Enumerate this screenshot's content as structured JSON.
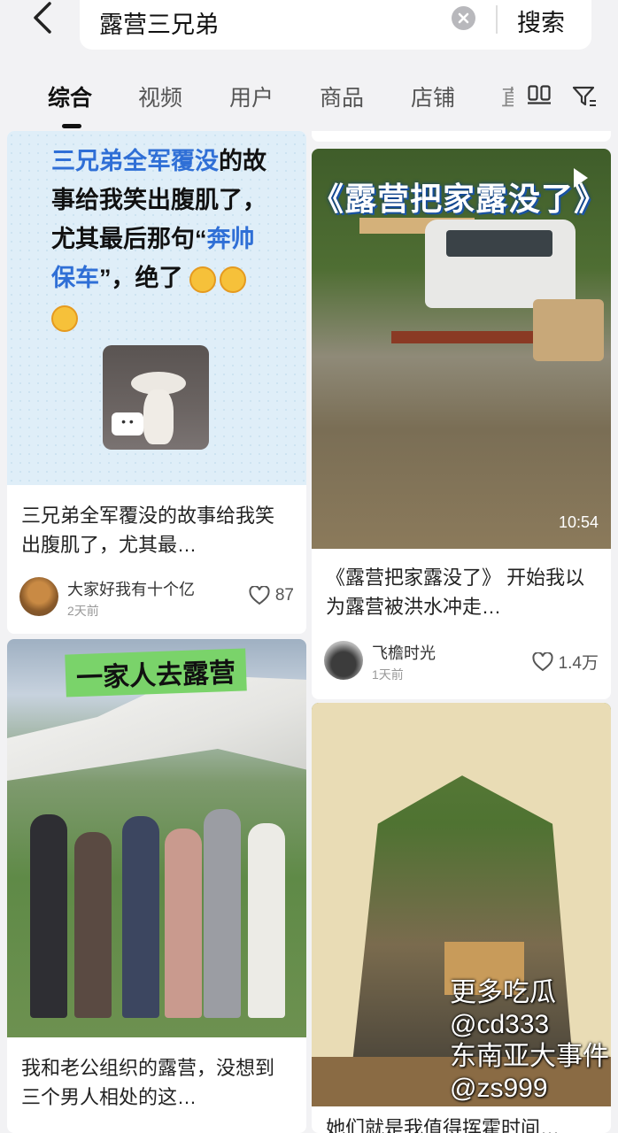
{
  "search": {
    "query": "露营三兄弟",
    "submit_label": "搜索"
  },
  "tabs": [
    "综合",
    "视频",
    "用户",
    "商品",
    "店铺"
  ],
  "cards": [
    {
      "title": "三兄弟全军覆没的故事给我笑出腹肌了，尤其最…",
      "meme_lines": [
        "三兄弟全军覆没",
        "的故事给我笑出腹肌了，尤其最后那句",
        "“",
        "奔帅保车",
        "”，绝了"
      ],
      "author": "大家好我有十个亿",
      "ago": "2天前",
      "likes": "87"
    },
    {
      "image_title": "《露营把家露没了》",
      "duration": "10:54",
      "title": "《露营把家露没了》 开始我以为露营被洪水冲走…",
      "author": "飞檐时光",
      "ago": "1天前",
      "likes": "1.4万"
    },
    {
      "image_title": "一家人去露营",
      "title": "我和老公组织的露营，没想到三个男人相处的这…"
    },
    {
      "title": "她们就是我值得挥霍时间…"
    }
  ],
  "watermark": [
    "更多吃瓜",
    "@cd333",
    "东南亚大事件",
    "@zs999"
  ]
}
